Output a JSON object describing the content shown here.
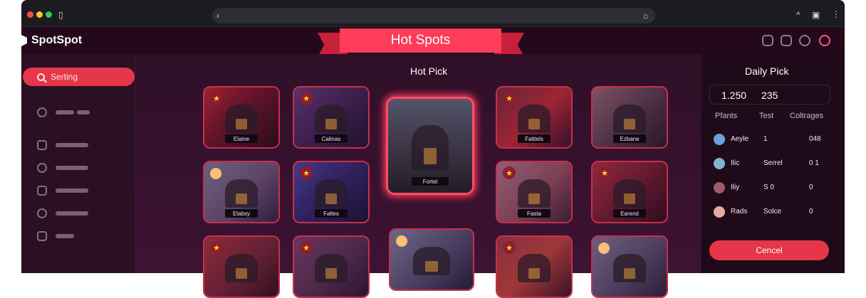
{
  "app": {
    "name": "SpotSpot"
  },
  "banner": {
    "title": "Hot Spots"
  },
  "sidebar": {
    "search_label": "Serting",
    "items": [
      {
        "icon": "clock-icon"
      },
      {
        "icon": "calendar-icon"
      },
      {
        "icon": "globe-icon"
      },
      {
        "icon": "shield-icon"
      },
      {
        "icon": "bulb-icon"
      },
      {
        "icon": "chat-icon"
      }
    ]
  },
  "main": {
    "title": "Hot Pick",
    "cards": [
      {
        "label": "Elaine",
        "badge": "★"
      },
      {
        "label": "Calinas",
        "badge": "★"
      },
      {
        "label": "Fattiels",
        "badge": "★"
      },
      {
        "label": "Ezbane",
        "badge": ""
      },
      {
        "label": "Elabsy",
        "badge": ""
      },
      {
        "label": "Faltes",
        "badge": "★"
      },
      {
        "label": "Fasta",
        "badge": "★"
      },
      {
        "label": "Earend",
        "badge": "★"
      },
      {
        "label": "",
        "badge": "★"
      },
      {
        "label": "",
        "badge": "★"
      },
      {
        "label": "",
        "badge": ""
      },
      {
        "label": "",
        "badge": "★"
      },
      {
        "label": "",
        "badge": ""
      }
    ],
    "featured": {
      "label": "Fortel"
    }
  },
  "daily": {
    "title": "Daily Pick",
    "stats": [
      "1.250",
      "235"
    ],
    "columns": [
      "Pfants",
      "Test",
      "Coltrages"
    ],
    "rows": [
      {
        "name": "Aeyle",
        "b": "1",
        "c": "048"
      },
      {
        "name": "Ilic",
        "b": "Serrel",
        "c": "0 1"
      },
      {
        "name": "Iliy",
        "b": "S 0",
        "c": "0"
      },
      {
        "name": "Rads",
        "b": "Solce",
        "c": "0"
      }
    ],
    "cancel": "Cencel"
  },
  "colors": {
    "accent": "#e6374a",
    "background": "#2a0f22"
  }
}
